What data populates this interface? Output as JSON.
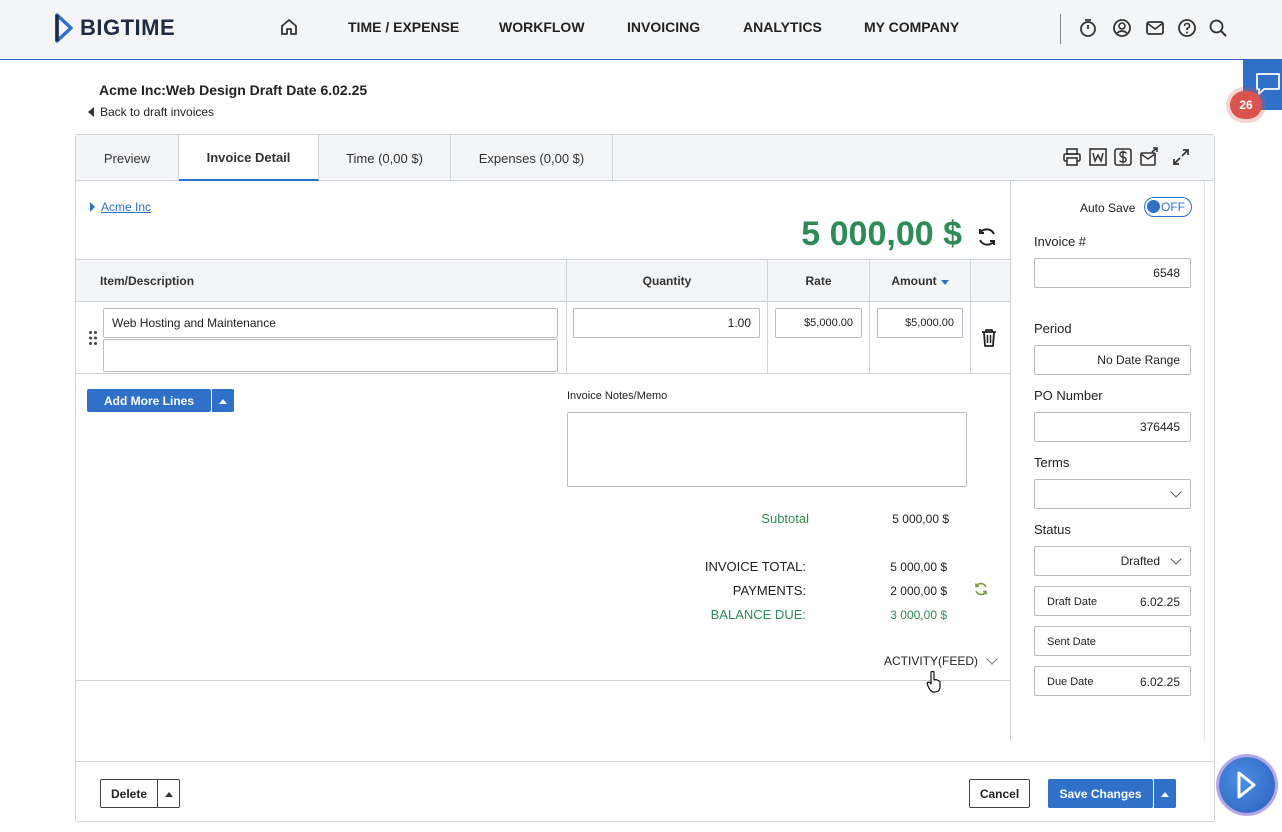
{
  "app": {
    "logo_text": "BIGTIME"
  },
  "nav": {
    "items": [
      "TIME / EXPENSE",
      "WORKFLOW",
      "INVOICING",
      "ANALYTICS",
      "MY COMPANY"
    ]
  },
  "notifications": {
    "count": "26"
  },
  "page": {
    "title": "Acme Inc:Web Design Draft Date 6.02.25",
    "back_link": "Back to draft invoices"
  },
  "tabs": [
    {
      "label": "Preview"
    },
    {
      "label": "Invoice Detail"
    },
    {
      "label": "Time (0,00 $)"
    },
    {
      "label": "Expenses (0,00 $)"
    }
  ],
  "invoice": {
    "client": "Acme Inc",
    "total_big": "5 000,00 $",
    "table_headers": {
      "item": "Item/Description",
      "quantity": "Quantity",
      "rate": "Rate",
      "amount": "Amount"
    },
    "lines": [
      {
        "description": "Web Hosting and Maintenance",
        "description2": "",
        "quantity": "1.00",
        "rate": "$5,000.00",
        "amount": "$5,000.00"
      }
    ],
    "add_lines_label": "Add More Lines",
    "notes_label": "Invoice Notes/Memo",
    "notes_value": "",
    "subtotal_label": "Subtotal",
    "subtotal_value": "5 000,00 $",
    "invoice_total_label": "INVOICE TOTAL:",
    "invoice_total_value": "5 000,00 $",
    "payments_label": "PAYMENTS:",
    "payments_value": "2 000,00 $",
    "balance_label": "BALANCE DUE:",
    "balance_value": "3 000,00 $",
    "activity_label": "ACTIVITY(FEED)"
  },
  "sidebar": {
    "autosave_label": "Auto Save",
    "autosave_state": "OFF",
    "invoice_no_label": "Invoice #",
    "invoice_no": "6548",
    "period_label": "Period",
    "period": "No Date Range",
    "po_label": "PO Number",
    "po": "376445",
    "terms_label": "Terms",
    "terms": "",
    "status_label": "Status",
    "status": "Drafted",
    "draft_date_label": "Draft Date",
    "draft_date": "6.02.25",
    "sent_date_label": "Sent Date",
    "sent_date": "",
    "due_date_label": "Due Date",
    "due_date": "6.02.25"
  },
  "footer": {
    "delete_label": "Delete",
    "cancel_label": "Cancel",
    "save_label": "Save Changes"
  },
  "colors": {
    "accent": "#2f70c9",
    "money_green": "#2e8b57",
    "badge": "#d9534f"
  }
}
